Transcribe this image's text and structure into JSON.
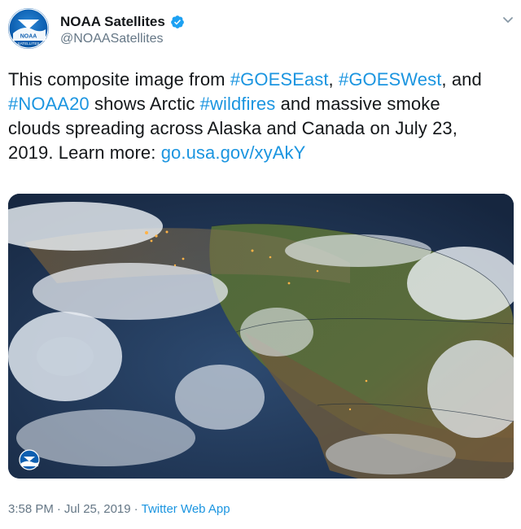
{
  "author": {
    "avatar_text_top": "NOAA",
    "avatar_text_bottom": "SATELLITES",
    "display_name": "NOAA Satellites",
    "handle": "@NOAASatellites",
    "verified": true
  },
  "tweet": {
    "line1": {
      "text1": "This composite image from ",
      "tag1": "#GOESEast",
      "text2": ", ",
      "tag2": "#GOESWest",
      "text3": ", and"
    },
    "line2": {
      "tag1": "#NOAA20",
      "text1": " shows Arctic ",
      "tag2": "#wildfires",
      "text2": " and massive smoke"
    },
    "line3": {
      "text1": "clouds spreading across Alaska and Canada on July 23,"
    },
    "line4": {
      "text1": "2019. Learn more: ",
      "link": "go.usa.gov/xyAkY"
    }
  },
  "media": {
    "description": "satellite composite image",
    "logo": "noaa-logo"
  },
  "footer": {
    "time": "3:58 PM",
    "separator": "·",
    "date": "Jul 25, 2019",
    "source": "Twitter Web App"
  },
  "icons": {
    "verified": "verified-badge-icon",
    "menu": "chevron-down-icon"
  },
  "colors": {
    "link": "#1b95e0",
    "text": "#14171a",
    "secondary": "#657786",
    "verified": "#1da1f2",
    "noaa_blue": "#0d5fb0"
  }
}
